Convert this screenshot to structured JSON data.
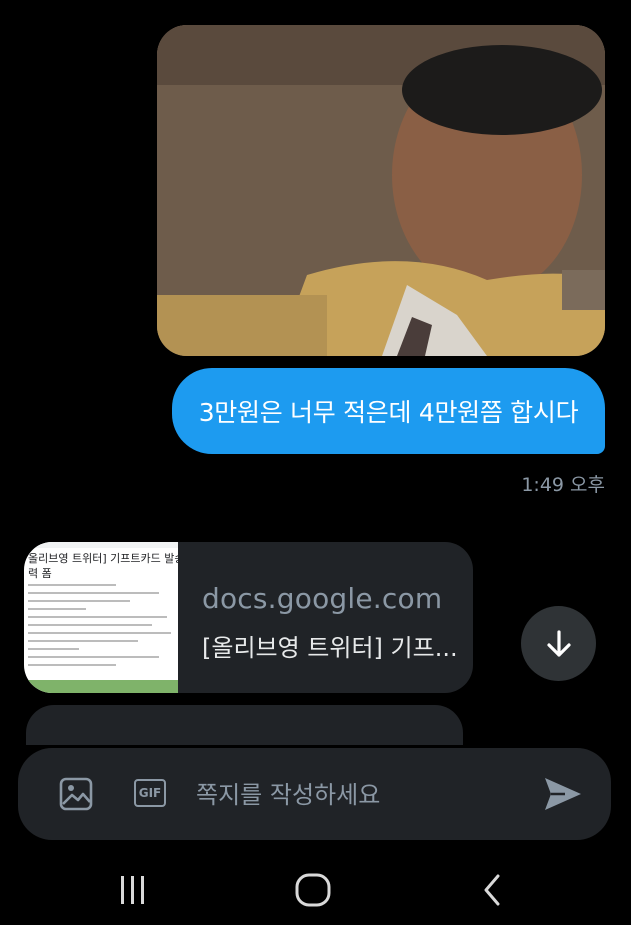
{
  "messages": {
    "image_message": {
      "description": "photo"
    },
    "outgoing_text": "3만원은 너무 적은데 4만원쯤 합시다",
    "timestamp": "1:49 오후",
    "link_card": {
      "thumbnail_title": "올리브영 트위터] 기프트카드 발송 정보",
      "thumbnail_subtitle": "력 폼",
      "domain": "docs.google.com",
      "title": "[올리브영 트위터] 기프..."
    }
  },
  "composer": {
    "placeholder": "쪽지를 작성하세요",
    "gif_label": "GIF"
  },
  "colors": {
    "accent": "#1d9bf0",
    "background": "#000000",
    "surface": "#202327",
    "muted": "#8b98a5"
  },
  "icons": [
    "image-icon",
    "gif-icon",
    "send-icon",
    "arrow-down-icon",
    "recents-icon",
    "home-icon",
    "back-icon"
  ]
}
